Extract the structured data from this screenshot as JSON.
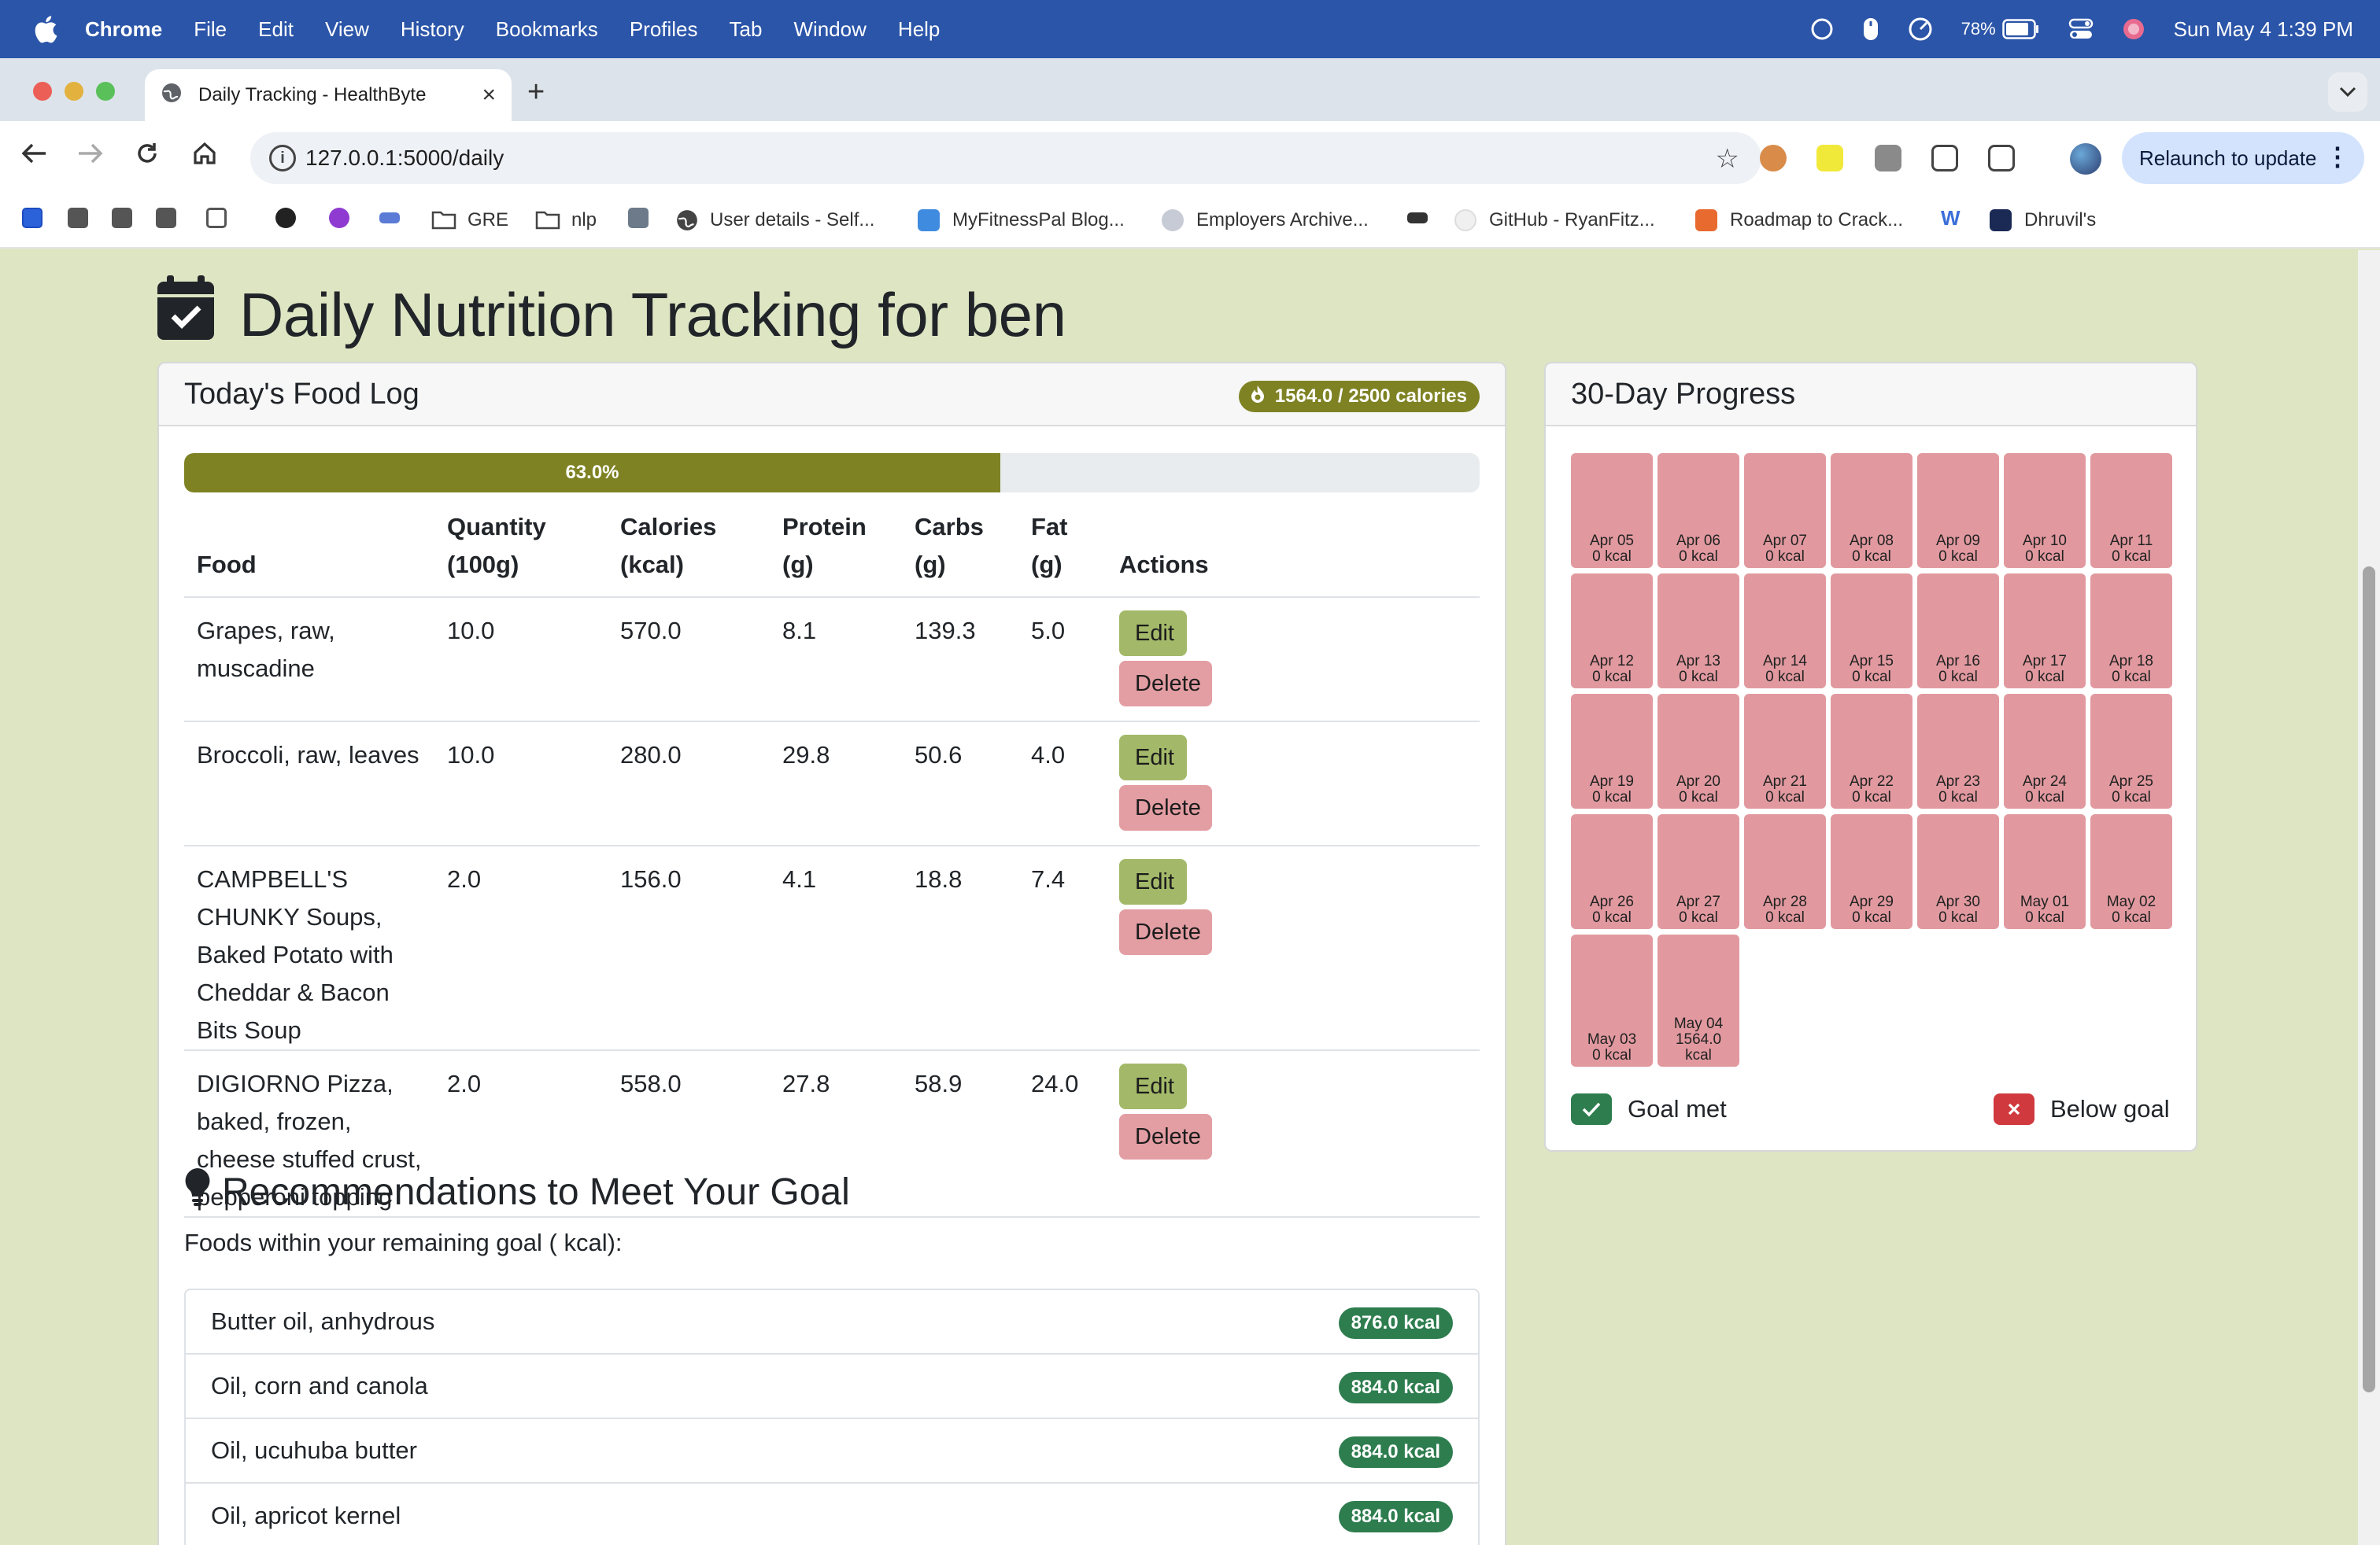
{
  "menubar": {
    "app": "Chrome",
    "items": [
      "File",
      "Edit",
      "View",
      "History",
      "Bookmarks",
      "Profiles",
      "Tab",
      "Window",
      "Help"
    ],
    "battery": "78%",
    "datetime": "Sun May 4  1:39 PM"
  },
  "browser": {
    "tab_title": "Daily Tracking - HealthByte",
    "url": "127.0.0.1:5000/daily",
    "relaunch": "Relaunch to update",
    "bookmarks": [
      "GRE",
      "nlp",
      "User details - Self...",
      "MyFitnessPal Blog...",
      "Employers Archive...",
      "GitHub - RyanFitz...",
      "Roadmap to Crack...",
      "Dhruvil's"
    ]
  },
  "page": {
    "title": "Daily Nutrition Tracking for ben"
  },
  "food_log": {
    "header": "Today's Food Log",
    "calorie_badge": "1564.0 / 2500 calories",
    "progress_label": "63.0%",
    "progress_fraction": 0.63,
    "columns": [
      [
        "Food"
      ],
      [
        "Quantity",
        "(100g)"
      ],
      [
        "Calories",
        "(kcal)"
      ],
      [
        "Protein",
        "(g)"
      ],
      [
        "Carbs",
        "(g)"
      ],
      [
        "Fat",
        "(g)"
      ],
      [
        "Actions"
      ]
    ],
    "edit_label": "Edit",
    "delete_label": "Delete",
    "rows": [
      {
        "food": "Grapes, raw, muscadine",
        "quantity": "10.0",
        "calories": "570.0",
        "protein": "8.1",
        "carbs": "139.3",
        "fat": "5.0"
      },
      {
        "food": "Broccoli, raw, leaves",
        "quantity": "10.0",
        "calories": "280.0",
        "protein": "29.8",
        "carbs": "50.6",
        "fat": "4.0"
      },
      {
        "food": "CAMPBELL'S CHUNKY Soups, Baked Potato with Cheddar & Bacon Bits Soup",
        "quantity": "2.0",
        "calories": "156.0",
        "protein": "4.1",
        "carbs": "18.8",
        "fat": "7.4"
      },
      {
        "food": "DIGIORNO Pizza, baked, frozen, cheese stuffed crust, pepperoni topping",
        "quantity": "2.0",
        "calories": "558.0",
        "protein": "27.8",
        "carbs": "58.9",
        "fat": "24.0"
      }
    ]
  },
  "recommendations": {
    "title": "Recommendations to Meet Your Goal",
    "subtitle": "Foods within your remaining goal ( kcal):",
    "items": [
      {
        "name": "Butter oil, anhydrous",
        "kcal": "876.0 kcal"
      },
      {
        "name": "Oil, corn and canola",
        "kcal": "884.0 kcal"
      },
      {
        "name": "Oil, ucuhuba butter",
        "kcal": "884.0 kcal"
      },
      {
        "name": "Oil, apricot kernel",
        "kcal": "884.0 kcal"
      }
    ]
  },
  "progress_30": {
    "header": "30-Day Progress",
    "days": [
      {
        "date": "Apr 05",
        "kcal": "0 kcal"
      },
      {
        "date": "Apr 06",
        "kcal": "0 kcal"
      },
      {
        "date": "Apr 07",
        "kcal": "0 kcal"
      },
      {
        "date": "Apr 08",
        "kcal": "0 kcal"
      },
      {
        "date": "Apr 09",
        "kcal": "0 kcal"
      },
      {
        "date": "Apr 10",
        "kcal": "0 kcal"
      },
      {
        "date": "Apr 11",
        "kcal": "0 kcal"
      },
      {
        "date": "Apr 12",
        "kcal": "0 kcal"
      },
      {
        "date": "Apr 13",
        "kcal": "0 kcal"
      },
      {
        "date": "Apr 14",
        "kcal": "0 kcal"
      },
      {
        "date": "Apr 15",
        "kcal": "0 kcal"
      },
      {
        "date": "Apr 16",
        "kcal": "0 kcal"
      },
      {
        "date": "Apr 17",
        "kcal": "0 kcal"
      },
      {
        "date": "Apr 18",
        "kcal": "0 kcal"
      },
      {
        "date": "Apr 19",
        "kcal": "0 kcal"
      },
      {
        "date": "Apr 20",
        "kcal": "0 kcal"
      },
      {
        "date": "Apr 21",
        "kcal": "0 kcal"
      },
      {
        "date": "Apr 22",
        "kcal": "0 kcal"
      },
      {
        "date": "Apr 23",
        "kcal": "0 kcal"
      },
      {
        "date": "Apr 24",
        "kcal": "0 kcal"
      },
      {
        "date": "Apr 25",
        "kcal": "0 kcal"
      },
      {
        "date": "Apr 26",
        "kcal": "0 kcal"
      },
      {
        "date": "Apr 27",
        "kcal": "0 kcal"
      },
      {
        "date": "Apr 28",
        "kcal": "0 kcal"
      },
      {
        "date": "Apr 29",
        "kcal": "0 kcal"
      },
      {
        "date": "Apr 30",
        "kcal": "0 kcal"
      },
      {
        "date": "May 01",
        "kcal": "0 kcal"
      },
      {
        "date": "May 02",
        "kcal": "0 kcal"
      },
      {
        "date": "May 03",
        "kcal": "0 kcal"
      },
      {
        "date": "May 04",
        "kcal": "1564.0 kcal"
      }
    ],
    "legend_met": "Goal met",
    "legend_below": "Below goal"
  },
  "colors": {
    "page_bg": "#dde5c3",
    "accent_olive": "#7e8223",
    "edit_green": "#a3b969",
    "delete_pink": "#e39ea3",
    "day_below": "#e1999f",
    "goal_met": "#2e7d4f",
    "below_goal": "#d0393e"
  }
}
